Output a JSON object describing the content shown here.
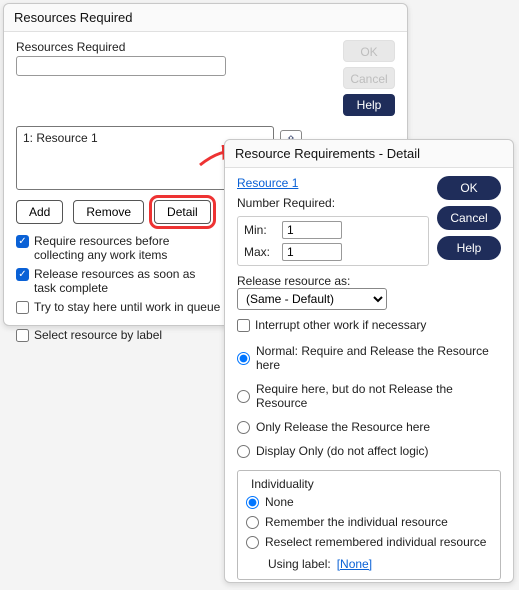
{
  "parent": {
    "title": "Resources Required",
    "field_label": "Resources Required",
    "field_value": "",
    "list_item": "1:   Resource 1",
    "buttons": {
      "ok": "OK",
      "cancel": "Cancel",
      "help": "Help"
    },
    "tool_buttons": {
      "add": "Add",
      "remove": "Remove",
      "detail": "Detail"
    },
    "checks": {
      "require": "Require resources before collecting any work items",
      "release": "Release resources as soon as task complete",
      "stay": "Try to stay here until work in queue is done",
      "bylabel": "Select resource by label"
    }
  },
  "child": {
    "title": "Resource Requirements - Detail",
    "resource_link": "Resource 1",
    "number_required_label": "Number Required:",
    "min_label": "Min:",
    "max_label": "Max:",
    "min_value": "1",
    "max_value": "1",
    "buttons": {
      "ok": "OK",
      "cancel": "Cancel",
      "help": "Help"
    },
    "release_label": "Release resource as:",
    "release_value": "(Same - Default)",
    "interrupt": "Interrupt other work if necessary",
    "mode": {
      "normal": "Normal: Require and Release the Resource here",
      "req_only": "Require here, but do not Release the Resource",
      "rel_only": "Only Release the Resource here",
      "display": "Display Only (do not affect logic)"
    },
    "indiv": {
      "legend": "Individuality",
      "none": "None",
      "remember": "Remember the individual resource",
      "reselect": "Reselect remembered individual resource",
      "using_label": "Using label:",
      "using_value": "[None]"
    }
  }
}
